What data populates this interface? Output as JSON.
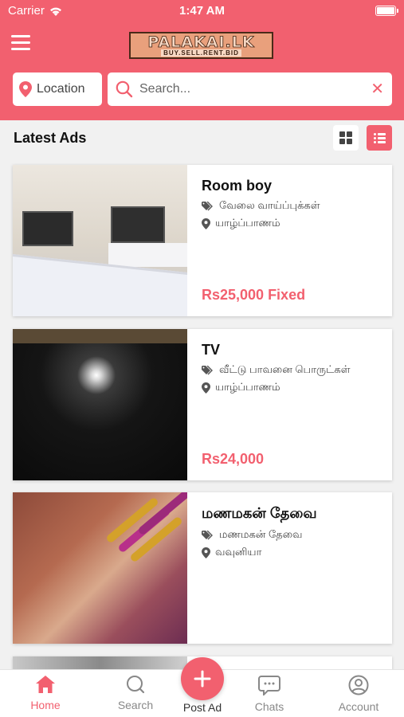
{
  "status_bar": {
    "carrier": "Carrier",
    "time": "1:47 AM"
  },
  "header": {
    "logo_main": "PALAKAI.LK",
    "logo_sub": "BUY.SELL.RENT.BID",
    "location_label": "Location",
    "search_placeholder": "Search..."
  },
  "section": {
    "title": "Latest Ads"
  },
  "ads": [
    {
      "title": "Room boy",
      "category": "வேலை வாய்ப்புக்கள்",
      "location": "யாழ்ப்பாணம்",
      "price": "Rs25,000 Fixed"
    },
    {
      "title": "TV",
      "category": "வீட்டு பாவனை பொருட்கள்",
      "location": "யாழ்ப்பாணம்",
      "price": "Rs24,000"
    },
    {
      "title": "மணமகன் தேவை",
      "category": "மணமகன் தேவை",
      "location": "வவுனியா",
      "price": ""
    }
  ],
  "tabs": [
    {
      "label": "Home",
      "icon": "home-icon",
      "active": true
    },
    {
      "label": "Search",
      "icon": "search-icon"
    },
    {
      "label": "Post Ad",
      "icon": "plus-icon"
    },
    {
      "label": "Chats",
      "icon": "chat-icon"
    },
    {
      "label": "Account",
      "icon": "account-icon"
    }
  ],
  "colors": {
    "accent": "#f2606f",
    "text": "#111111",
    "muted": "#888888"
  }
}
